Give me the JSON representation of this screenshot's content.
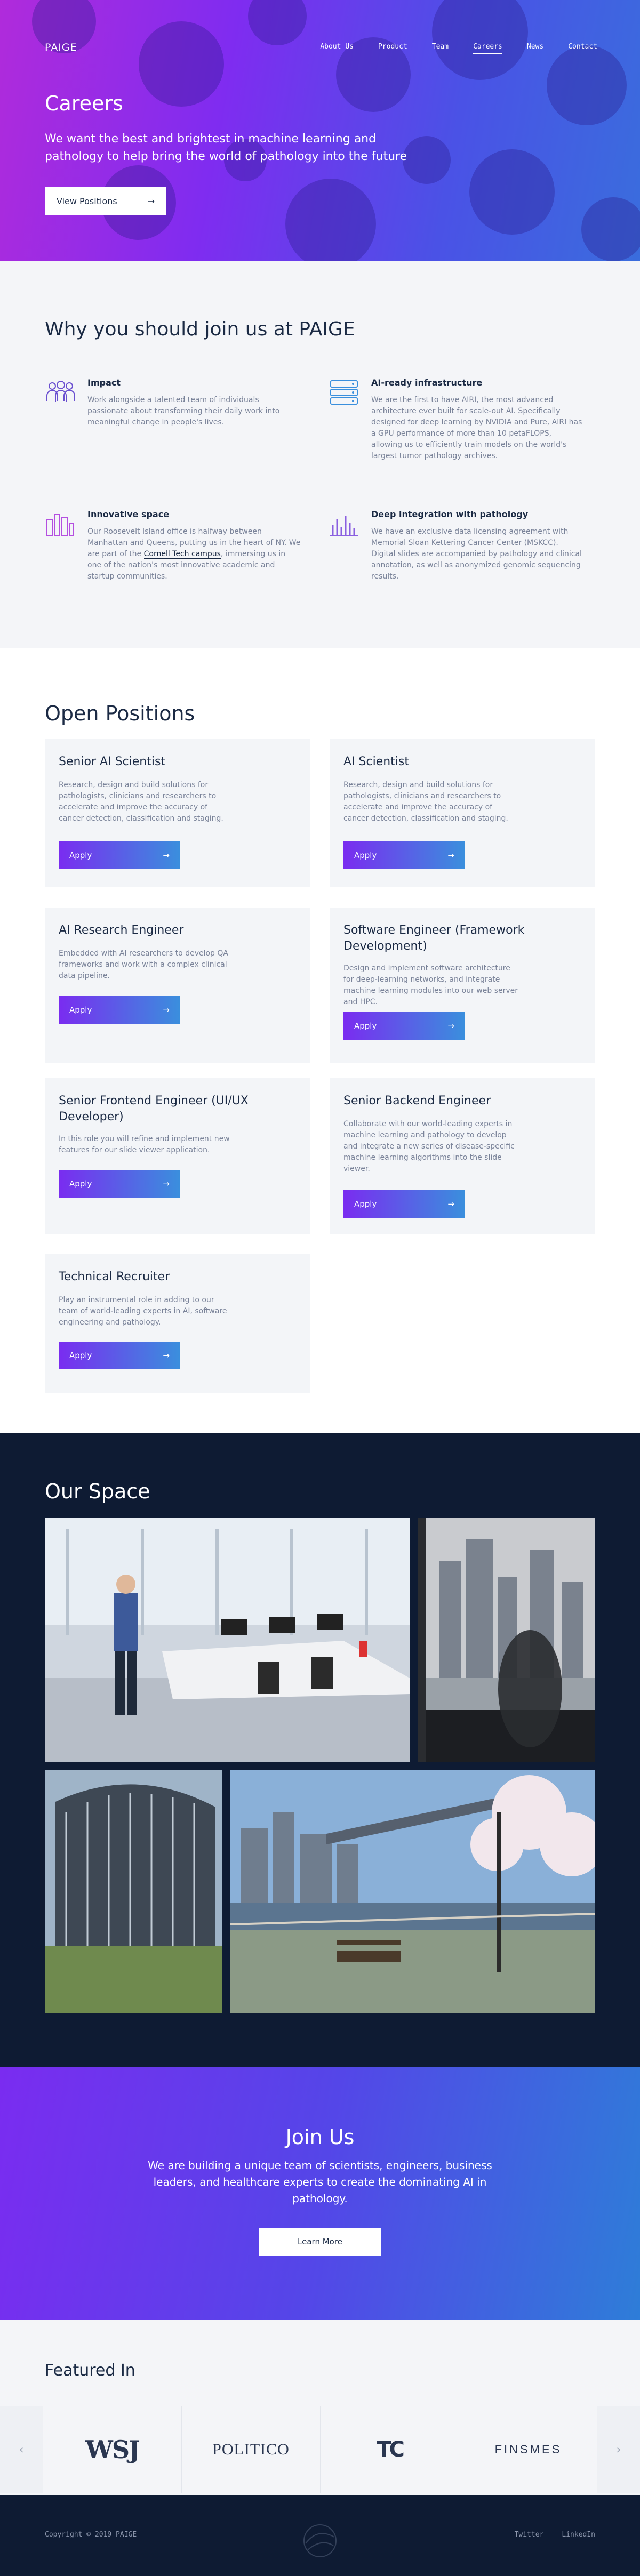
{
  "header": {
    "logo": "PAIGE",
    "nav": [
      "About Us",
      "Product",
      "Team",
      "Careers",
      "News",
      "Contact"
    ],
    "active": "Careers"
  },
  "hero": {
    "title": "Careers",
    "subtitle": "We want the best and brightest in machine learning and pathology to help bring the world of pathology into the future",
    "button": "View Positions"
  },
  "why": {
    "title": "Why you should join us at PAIGE",
    "features": [
      {
        "icon": "people-icon",
        "title": "Impact",
        "text": "Work alongside a talented team of individuals passionate about transforming their daily work into meaningful change in people's lives."
      },
      {
        "icon": "server-icon",
        "title": "AI-ready infrastructure",
        "text": "We are the first to have AIRI, the most advanced architecture ever built for scale-out AI. Specifically designed for deep learning by NVIDIA and Pure, AIRI has a GPU performance of more than 10 petaFLOPS, allowing us to efficiently train models on the world's largest tumor pathology archives."
      },
      {
        "icon": "city-icon",
        "title": "Innovative space",
        "text_a": "Our Roosevelt Island office is halfway between Manhattan and Queens, putting us in the heart of NY. We are part of the ",
        "link": "Cornell Tech campus",
        "text_b": ", immersing us in one of the nation's most innovative academic and startup communities."
      },
      {
        "icon": "chart-icon",
        "title": "Deep integration with pathology",
        "text": "We have an exclusive data licensing agreement with Memorial Sloan Kettering Cancer Center (MSKCC). Digital slides are accompanied by pathology and clinical annotation, as well as anonymized genomic sequencing results."
      }
    ]
  },
  "positions": {
    "title": "Open Positions",
    "apply_label": "Apply",
    "items": [
      {
        "title": "Senior AI Scientist",
        "text": "Research, design and build solutions for pathologists, clinicians and researchers to accelerate and improve the accuracy of cancer detection, classification and staging."
      },
      {
        "title": "AI Scientist",
        "text": "Research, design and build solutions for pathologists, clinicians and researchers to accelerate and improve the accuracy of cancer detection, classification and staging."
      },
      {
        "title": "AI Research Engineer",
        "text": "Embedded with AI researchers to develop QA frameworks and work with a complex clinical data pipeline."
      },
      {
        "title": "Software Engineer (Framework Development)",
        "text": "Design and implement software architecture for deep-learning networks, and integrate machine learning modules into our web server and HPC."
      },
      {
        "title": "Senior Frontend Engineer (UI/UX Developer)",
        "text": "In this role you will refine and implement new features for our slide viewer application."
      },
      {
        "title": "Senior Backend Engineer",
        "text": "Collaborate with our world-leading experts in machine learning and pathology to develop and integrate a new series of disease-specific machine learning algorithms into the slide viewer."
      },
      {
        "title": "Technical Recruiter",
        "text": "Play an instrumental role in adding to our team of world-leading experts in AI, software engineering and pathology."
      }
    ]
  },
  "space": {
    "title": "Our Space"
  },
  "join": {
    "title": "Join Us",
    "text": "We are building a unique team of scientists, engineers, business leaders, and healthcare experts to create the dominating AI in pathology.",
    "button": "Learn More"
  },
  "featured": {
    "title": "Featured In",
    "logos": [
      "WSJ",
      "POLITICO",
      "TC",
      "FINSMES"
    ]
  },
  "footer": {
    "copyright": "Copyright © 2019 PAIGE",
    "links": [
      "Twitter",
      "LinkedIn"
    ]
  },
  "colors": {
    "accent_purple": "#7a2cf0",
    "accent_blue": "#3a8fdd",
    "navy": "#0e1b33"
  }
}
